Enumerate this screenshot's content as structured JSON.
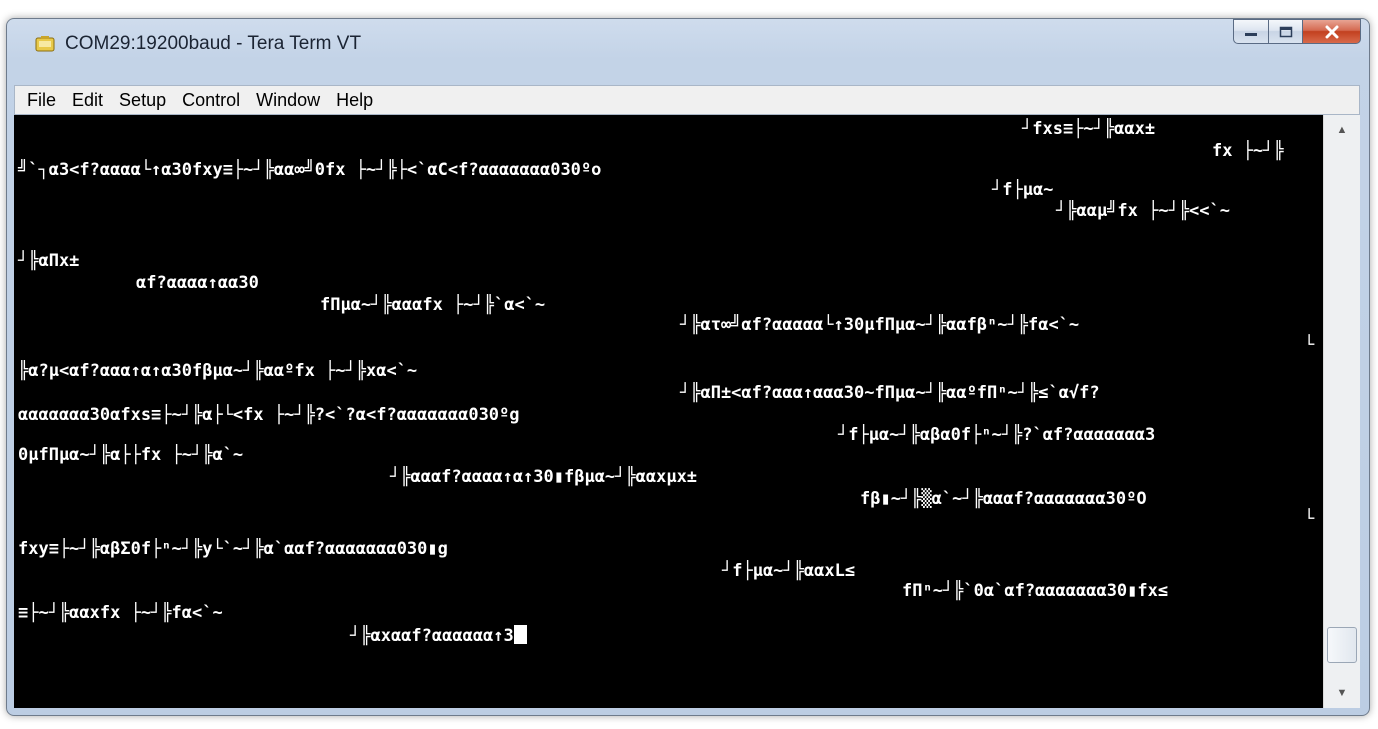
{
  "window": {
    "title": "COM29:19200baud - Tera Term VT",
    "icon": "tera-term-app-icon",
    "controls": {
      "minimize_icon": "minimize-icon",
      "maximize_icon": "maximize-icon",
      "close_icon": "close-icon"
    }
  },
  "menu": [
    "File",
    "Edit",
    "Setup",
    "Control",
    "Window",
    "Help"
  ],
  "terminal": {
    "background": "#000000",
    "foreground": "#ffffff",
    "lines": [
      "┘fxs≡├~┘╠ααx±",
      "fx ├~┘╠",
      "╝`┐α3<f?αααα└↑α30fxy≡├~┘╠αα∞╝0fx ├~┘╠├<`αC<f?ααααααα030ºo",
      "┘f├μα~",
      "┘╠ααμ╝fx ├~┘╠<<`~",
      "┘╠αΠx±",
      "αf?αααα↑αα30",
      "fΠμα~┘╠αααfx ├~┘╠`α<`~",
      "┘╠ατ∞╝αf?ααααα└↑30μfΠμα~┘╠ααfβⁿ~┘╠fα<`~",
      "└",
      "╠α?μ<αf?ααα↑α↑α30fβμα~┘╠ααºfx ├~┘╠xα<`~",
      "┘╠αΠ±<αf?ααα↑ααα30~fΠμα~┘╠ααºfΠⁿ~┘╠≤`α√f?",
      "ααααααα30αfxs≡├~┘╠α├└<fx ├~┘╠?<`?α<f?ααααααα030ºg",
      "┘f├μα~┘╠αβα0f├ⁿ~┘╠?`αf?ααααααα3",
      "0μfΠμα~┘╠α├├fx ├~┘╠α`~",
      "┘╠αααf?αααα↑α↑30▮fβμα~┘╠ααxμx±",
      "fβ▮~┘╠▒α`~┘╠αααf?ααααααα30ºO",
      "└",
      "fxy≡├~┘╠αβΣ0f├ⁿ~┘╠y└`~┘╠α`ααf?ααααααα030▮g",
      "┘f├μα~┘╠ααxL≤",
      "fΠⁿ~┘╠`0α`αf?ααααααα30▮fx≤",
      "≡├~┘╠ααxfx ├~┘╠fα<`~",
      "┘╠αxααf?αααααα↑3"
    ]
  },
  "scrollbar": {
    "up_icon": "scroll-up-arrow-icon",
    "down_icon": "scroll-down-arrow-icon"
  }
}
